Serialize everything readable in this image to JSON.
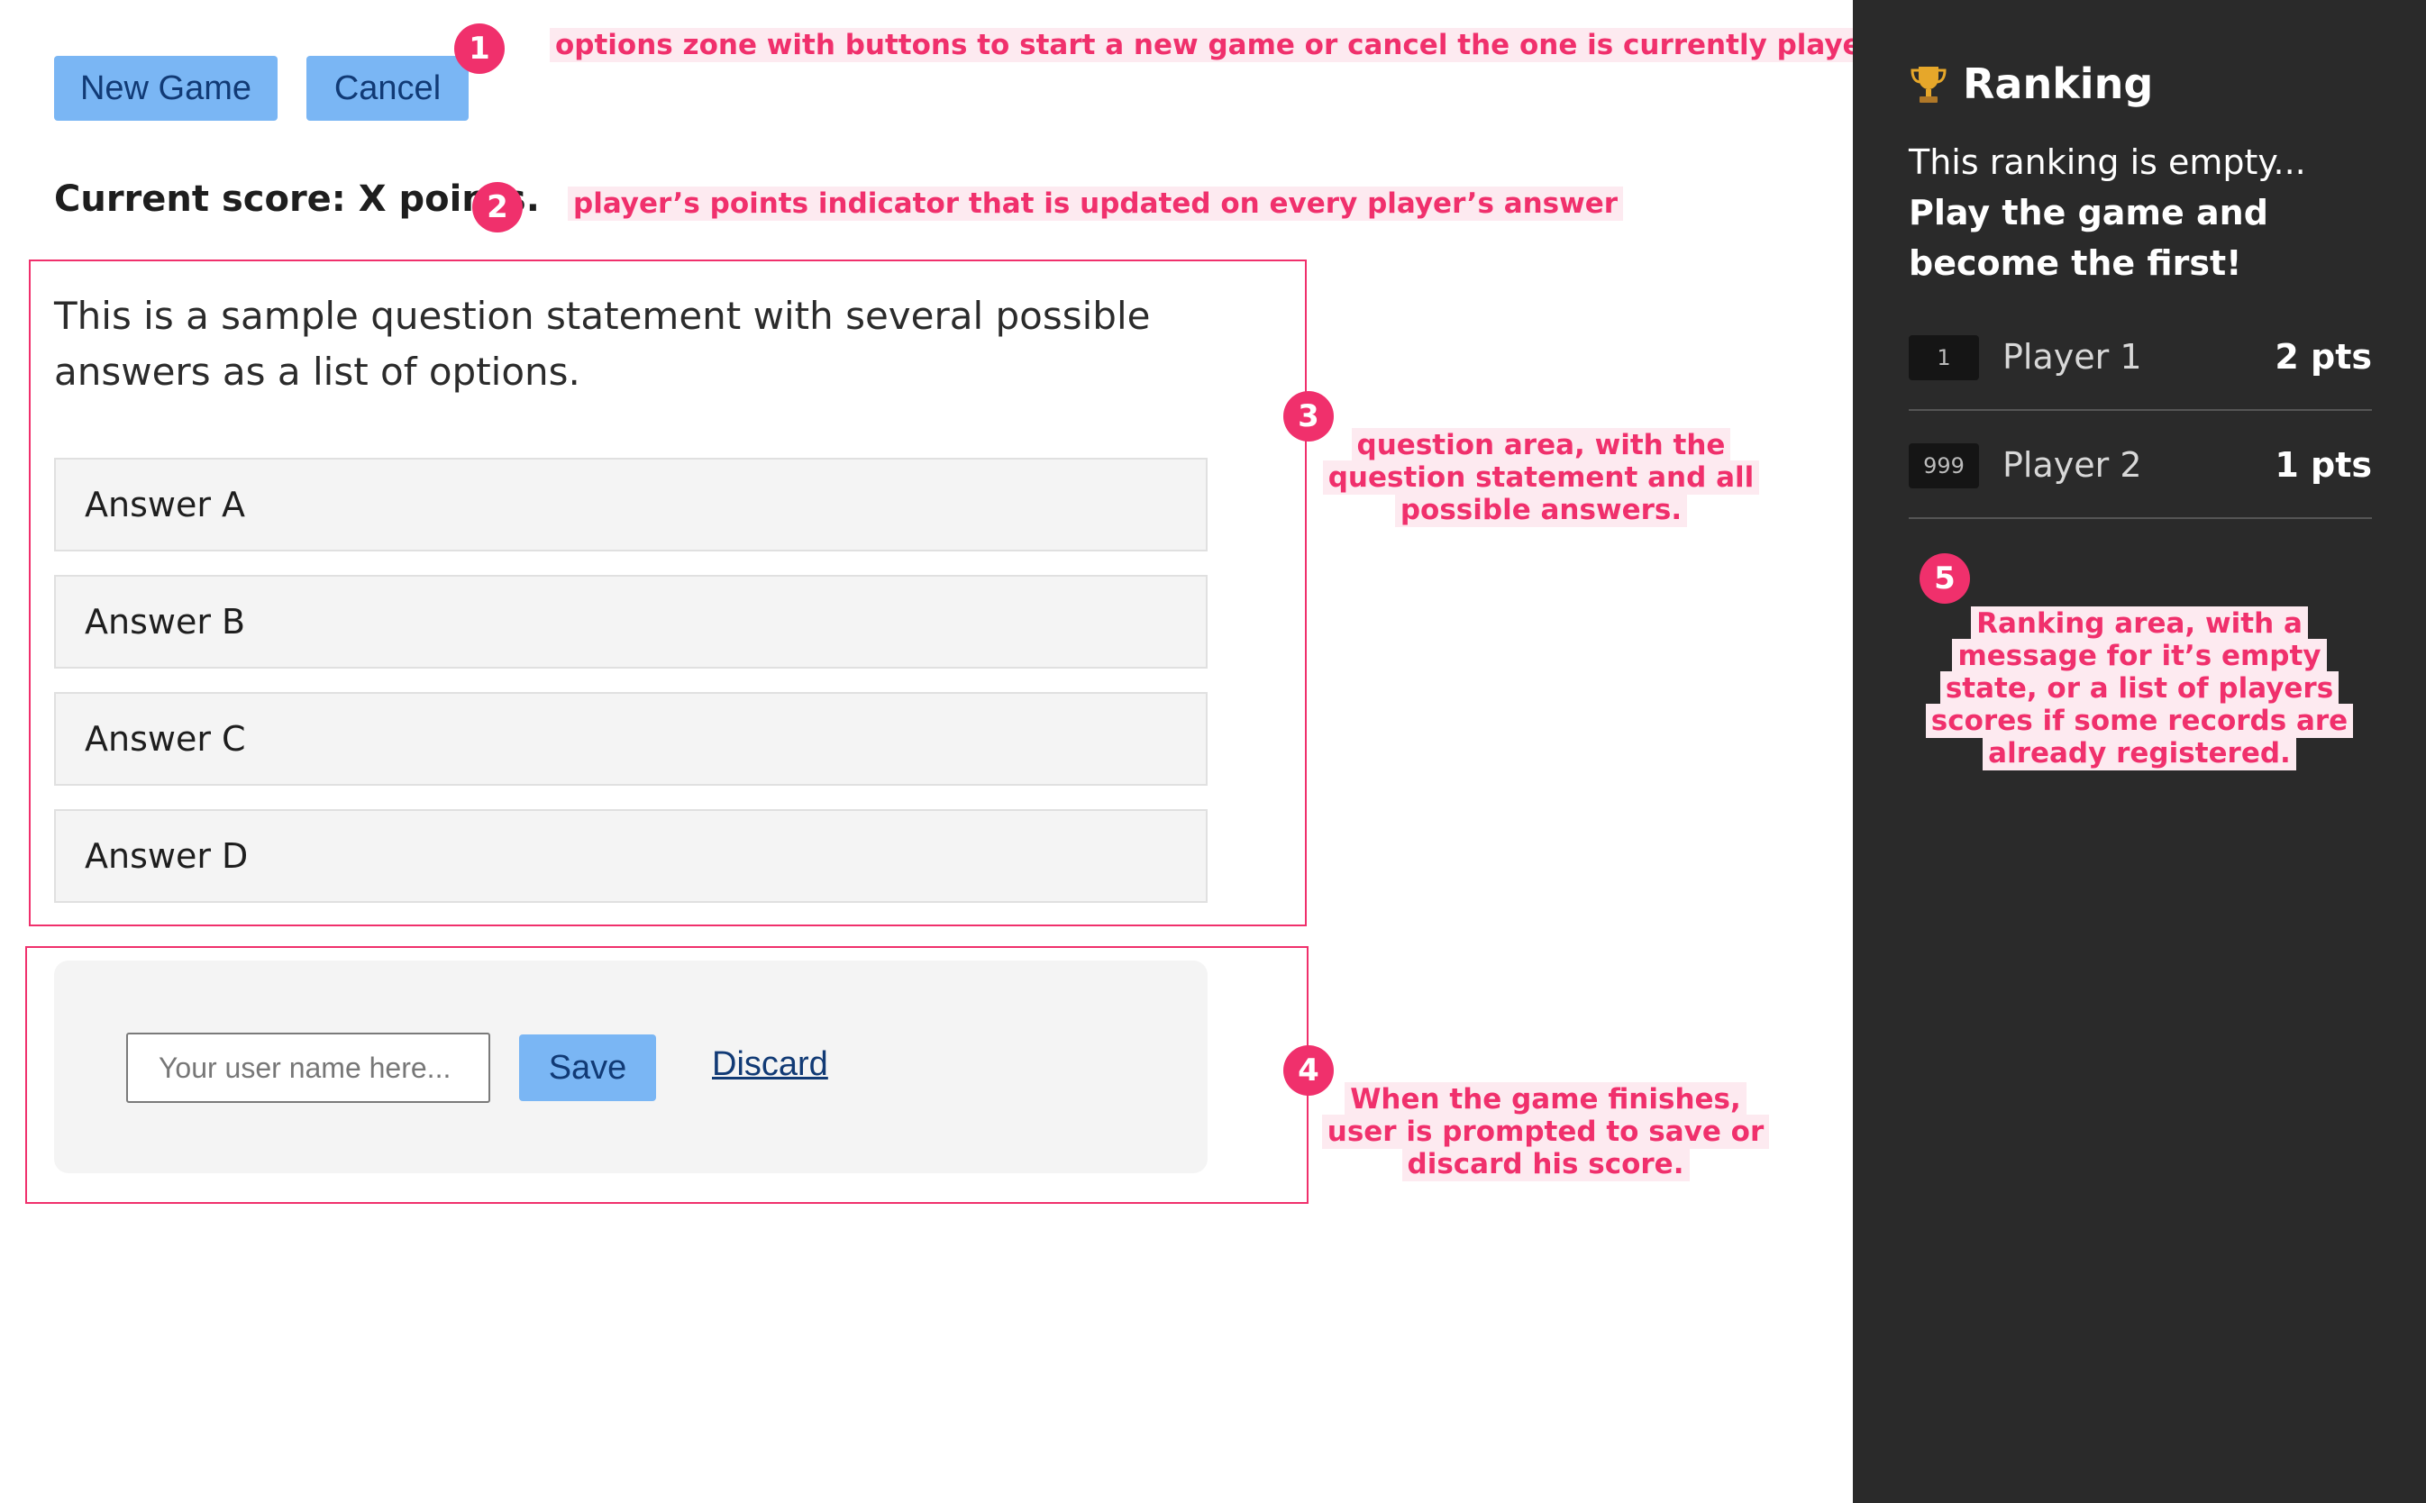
{
  "options": {
    "new_game_label": "New Game",
    "cancel_label": "Cancel"
  },
  "score": {
    "text": "Current score: X points."
  },
  "question": {
    "statement": "This is a sample question statement with several possible answers as a list of options.",
    "answers": [
      "Answer A",
      "Answer B",
      "Answer C",
      "Answer D"
    ]
  },
  "save_form": {
    "placeholder": "Your user name here...",
    "save_label": "Save",
    "discard_label": "Discard"
  },
  "ranking": {
    "title": "Ranking",
    "icon": "trophy-icon",
    "empty_message_plain": "This ranking is empty... ",
    "empty_message_bold": "Play the game and become the first!",
    "entries": [
      {
        "position": "1",
        "name": "Player 1",
        "points": "2 pts"
      },
      {
        "position": "999",
        "name": "Player 2",
        "points": "1 pts"
      }
    ]
  },
  "annotations": [
    {
      "number": "1",
      "text": "options zone with buttons to start a new game or cancel the one is currently played."
    },
    {
      "number": "2",
      "text": "player’s points indicator that is updated on every player’s answer"
    },
    {
      "number": "3",
      "lines": [
        "question area, with the",
        "question statement and all",
        "possible answers."
      ]
    },
    {
      "number": "4",
      "lines": [
        "When the game finishes,",
        "user is prompted to save or",
        "discard his score."
      ]
    },
    {
      "number": "5",
      "lines": [
        "Ranking area, with a",
        "message for it’s empty",
        "state, or a list of players",
        "scores if some records are",
        "already registered."
      ]
    }
  ],
  "colors": {
    "accent_button": "#7ab6f4",
    "annotation": "#f0306c",
    "sidebar_bg": "#2a2a2a",
    "answer_bg": "#f4f4f4"
  }
}
